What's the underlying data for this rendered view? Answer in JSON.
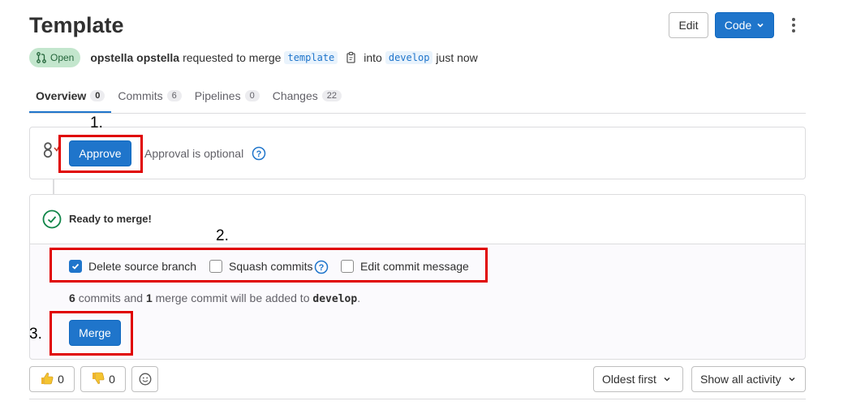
{
  "header": {
    "title": "Template",
    "edit_label": "Edit",
    "code_label": "Code"
  },
  "meta": {
    "status": "Open",
    "author": "opstella opstella",
    "action": "requested to merge",
    "source_branch": "template",
    "into": "into",
    "target_branch": "develop",
    "time": "just now"
  },
  "tabs": [
    {
      "label": "Overview",
      "count": "0"
    },
    {
      "label": "Commits",
      "count": "6"
    },
    {
      "label": "Pipelines",
      "count": "0"
    },
    {
      "label": "Changes",
      "count": "22"
    }
  ],
  "annotations": {
    "step1": "1.",
    "step2": "2.",
    "step3": "3."
  },
  "approval": {
    "button": "Approve",
    "text": "Approval is optional"
  },
  "merge": {
    "status": "Ready to merge!",
    "options": [
      {
        "label": "Delete source branch",
        "checked": true
      },
      {
        "label": "Squash commits",
        "checked": false
      },
      {
        "label": "Edit commit message",
        "checked": false
      }
    ],
    "note": {
      "commit_count": "6",
      "commits_text": "commits and",
      "merge_count": "1",
      "merge_text": "merge commit will be added to",
      "branch": "develop",
      "end": "."
    },
    "button": "Merge"
  },
  "reactions": {
    "thumbs_up": "0",
    "thumbs_down": "0"
  },
  "activity": {
    "sort": "Oldest first",
    "filter": "Show all activity"
  },
  "colors": {
    "primary": "#1f75cb",
    "annotation_red": "#e00000",
    "success": "#108548"
  }
}
